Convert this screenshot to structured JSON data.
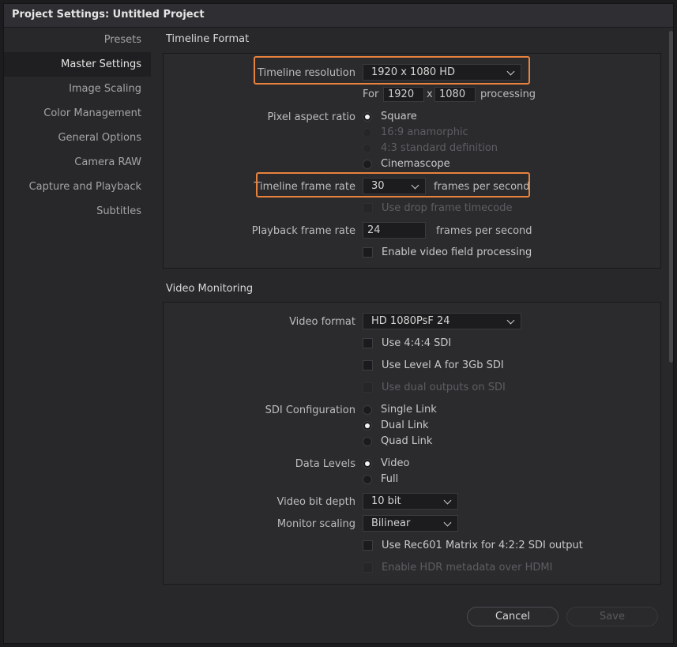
{
  "window": {
    "title": "Project Settings:  Untitled Project"
  },
  "sidebar": {
    "items": [
      {
        "label": "Presets"
      },
      {
        "label": "Master Settings",
        "active": true
      },
      {
        "label": "Image Scaling"
      },
      {
        "label": "Color Management"
      },
      {
        "label": "General Options"
      },
      {
        "label": "Camera RAW"
      },
      {
        "label": "Capture and Playback"
      },
      {
        "label": "Subtitles"
      }
    ]
  },
  "timeline_format": {
    "section_title": "Timeline Format",
    "resolution_label": "Timeline resolution",
    "resolution_value": "1920 x 1080 HD",
    "for_label": "For",
    "width": "1920",
    "x_label": "x",
    "height": "1080",
    "processing_label": "processing",
    "pixel_aspect_label": "Pixel aspect ratio",
    "pixel_aspect_options": [
      {
        "label": "Square",
        "selected": true,
        "enabled": true
      },
      {
        "label": "16:9 anamorphic",
        "selected": false,
        "enabled": false
      },
      {
        "label": "4:3 standard definition",
        "selected": false,
        "enabled": false
      },
      {
        "label": "Cinemascope",
        "selected": false,
        "enabled": true
      }
    ],
    "frame_rate_label": "Timeline frame rate",
    "frame_rate_value": "30",
    "fps_label": "frames per second",
    "drop_frame_label": "Use drop frame timecode",
    "playback_rate_label": "Playback frame rate",
    "playback_rate_value": "24",
    "playback_fps_label": "frames per second",
    "field_processing_label": "Enable video field processing"
  },
  "video_monitoring": {
    "section_title": "Video Monitoring",
    "video_format_label": "Video format",
    "video_format_value": "HD 1080PsF 24",
    "use_444_label": "Use 4:4:4 SDI",
    "level_a_label": "Use Level A for 3Gb SDI",
    "dual_outputs_label": "Use dual outputs on SDI",
    "sdi_config_label": "SDI Configuration",
    "sdi_options": [
      {
        "label": "Single Link",
        "selected": false
      },
      {
        "label": "Dual Link",
        "selected": true
      },
      {
        "label": "Quad Link",
        "selected": false
      }
    ],
    "data_levels_label": "Data Levels",
    "data_levels_options": [
      {
        "label": "Video",
        "selected": true
      },
      {
        "label": "Full",
        "selected": false
      }
    ],
    "bit_depth_label": "Video bit depth",
    "bit_depth_value": "10 bit",
    "monitor_scaling_label": "Monitor scaling",
    "monitor_scaling_value": "Bilinear",
    "rec601_label": "Use Rec601 Matrix for 4:2:2 SDI output",
    "hdr_label": "Enable HDR metadata over HDMI"
  },
  "buttons": {
    "cancel": "Cancel",
    "save": "Save"
  },
  "colors": {
    "highlight": "#e8823d",
    "background": "#28282b",
    "panel": "#2b2b2e"
  }
}
